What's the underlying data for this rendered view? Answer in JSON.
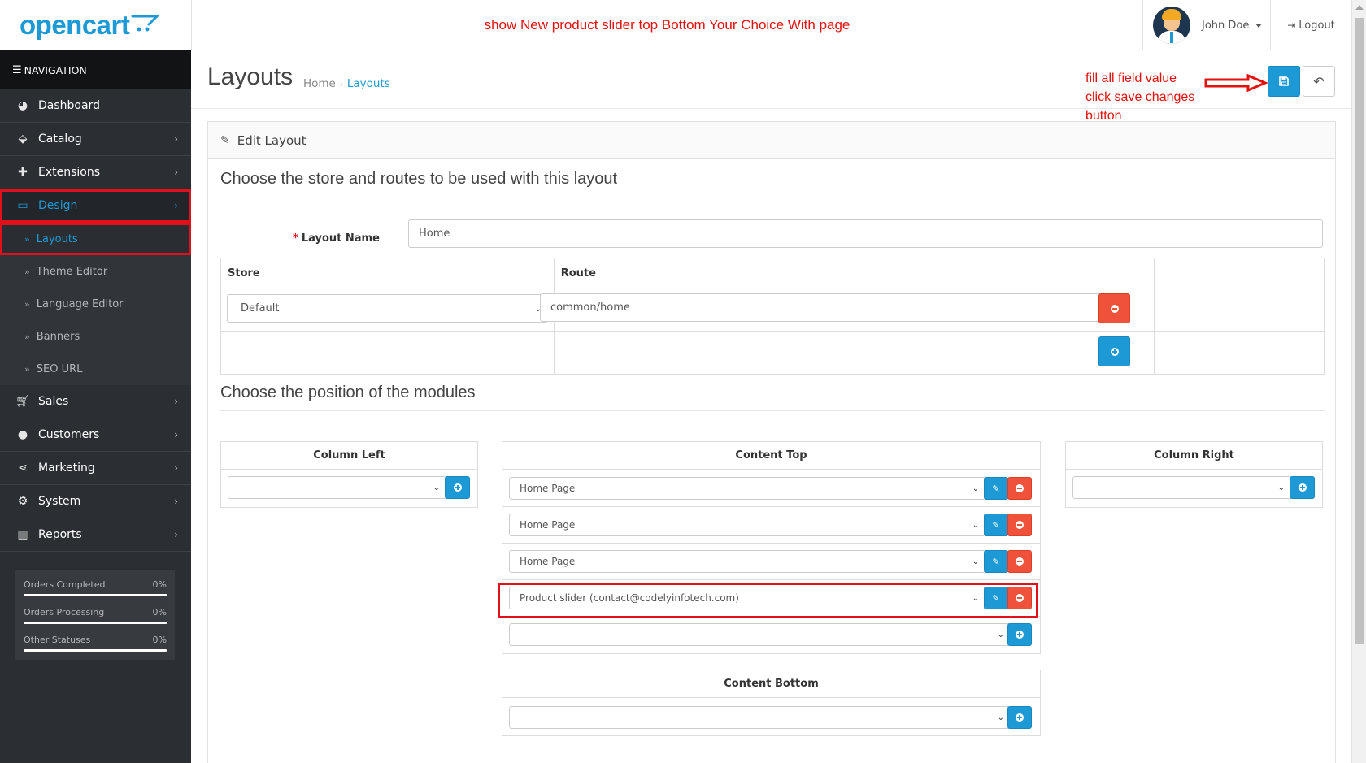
{
  "header": {
    "brand": "opencart",
    "note": "show New product slider top Bottom Your Choice With page",
    "user_name": "John Doe",
    "logout_label": "Logout"
  },
  "sidebar": {
    "nav_title": "NAVIGATION",
    "items": [
      {
        "label": "Dashboard",
        "icon": "dashboard-icon"
      },
      {
        "label": "Catalog",
        "icon": "tags-icon"
      },
      {
        "label": "Extensions",
        "icon": "puzzle-icon"
      },
      {
        "label": "Design",
        "icon": "monitor-icon"
      },
      {
        "label": "Sales",
        "icon": "cart-icon"
      },
      {
        "label": "Customers",
        "icon": "user-icon"
      },
      {
        "label": "Marketing",
        "icon": "share-icon"
      },
      {
        "label": "System",
        "icon": "gear-icon"
      },
      {
        "label": "Reports",
        "icon": "bar-chart-icon"
      }
    ],
    "design_sub": [
      "Layouts",
      "Theme Editor",
      "Language Editor",
      "Banners",
      "SEO URL"
    ],
    "stats": [
      {
        "label": "Orders Completed",
        "value": "0%",
        "fill": 0
      },
      {
        "label": "Orders Processing",
        "value": "0%",
        "fill": 0
      },
      {
        "label": "Other Statuses",
        "value": "0%",
        "fill": 0
      }
    ]
  },
  "page": {
    "title": "Layouts",
    "breadcrumb": [
      "Home",
      "Layouts"
    ],
    "annotation": [
      "fill all field value",
      "click save changes",
      "button"
    ],
    "panel_title": "Edit Layout",
    "legend_routes": "Choose the store and routes to be used with this layout",
    "legend_modules": "Choose the position of the modules"
  },
  "form": {
    "layout_name_label": "Layout Name",
    "layout_name_value": "Home",
    "store_header": "Store",
    "route_header": "Route",
    "store_value": "Default",
    "route_value": "common/home"
  },
  "positions": {
    "column_left": "Column Left",
    "content_top": "Content Top",
    "column_right": "Column Right",
    "content_bottom": "Content Bottom",
    "content_top_modules": [
      "Home Page",
      "Home Page",
      "Home Page",
      "Product slider (contact@codelyinfotech.com)"
    ],
    "highlighted_module_index": 3
  },
  "colors": {
    "brand_blue": "#1d9ad6",
    "annotation_red": "#e3110d",
    "danger_red": "#f0513b",
    "sidebar_bg": "#2b2f33"
  }
}
